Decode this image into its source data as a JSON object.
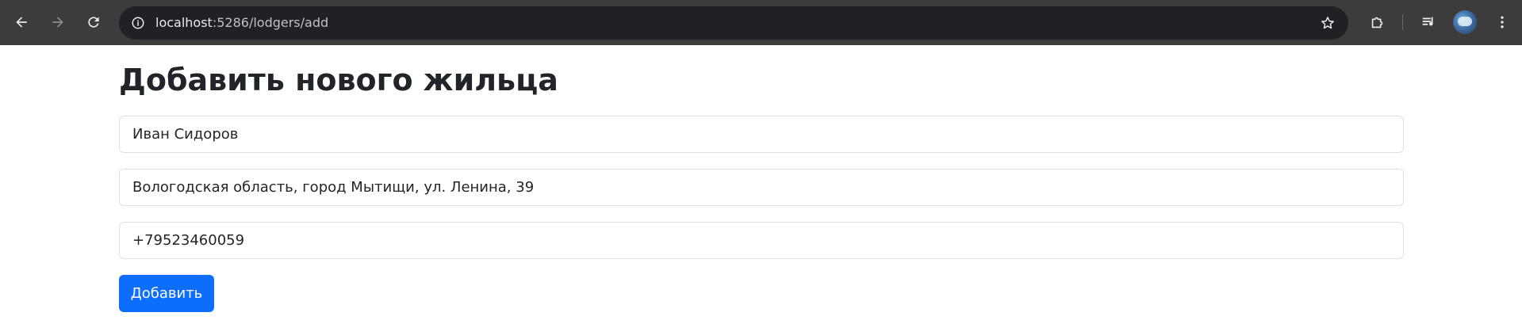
{
  "browser": {
    "url_host": "localhost",
    "url_path": ":5286/lodgers/add",
    "icons": {
      "back": "back-arrow-icon",
      "forward": "forward-arrow-icon",
      "reload": "reload-icon",
      "site_info": "info-icon",
      "bookmark": "star-icon",
      "extensions": "puzzle-icon",
      "media": "media-queue-icon",
      "profile": "avatar",
      "menu": "kebab-menu-icon"
    },
    "colors": {
      "frame": "#3c3c3c",
      "omnibox": "#202124",
      "icon": "#e8eaed",
      "icon_disabled": "#8e8e8e"
    }
  },
  "form": {
    "title": "Добавить нового жильца",
    "name_value": "Иван Сидоров",
    "address_value": "Вологодская область, город Мытищи, ул. Ленина, 39",
    "phone_value": "+79523460059",
    "submit_label": "Добавить",
    "colors": {
      "primary": "#0d6efd",
      "text": "#212529",
      "border": "#dee2e6"
    }
  }
}
